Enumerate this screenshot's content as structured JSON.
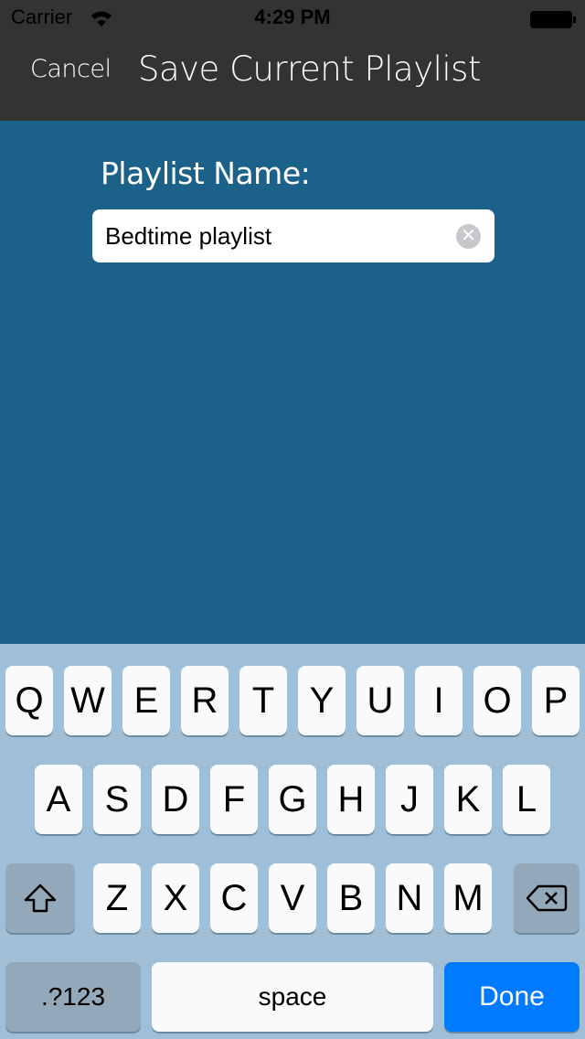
{
  "status_bar": {
    "carrier": "Carrier",
    "time": "4:29 PM",
    "wifi_icon": "wifi-icon",
    "battery_icon": "battery-full-icon"
  },
  "header": {
    "cancel_label": "Cancel",
    "title": "Save Current Playlist"
  },
  "form": {
    "label": "Playlist Name:",
    "value": "Bedtime playlist",
    "clear_icon": "clear-circle-icon"
  },
  "keyboard": {
    "row1": [
      "Q",
      "W",
      "E",
      "R",
      "T",
      "Y",
      "U",
      "I",
      "O",
      "P"
    ],
    "row2": [
      "A",
      "S",
      "D",
      "F",
      "G",
      "H",
      "J",
      "K",
      "L"
    ],
    "row3": [
      "Z",
      "X",
      "C",
      "V",
      "B",
      "N",
      "M"
    ],
    "numbers_label": ".?123",
    "space_label": "space",
    "done_label": "Done",
    "shift_icon": "shift-icon",
    "delete_icon": "delete-icon"
  },
  "colors": {
    "header": "#333333",
    "background": "#1c6189",
    "keyboard": "#a0bfd6",
    "done": "#007aff"
  }
}
